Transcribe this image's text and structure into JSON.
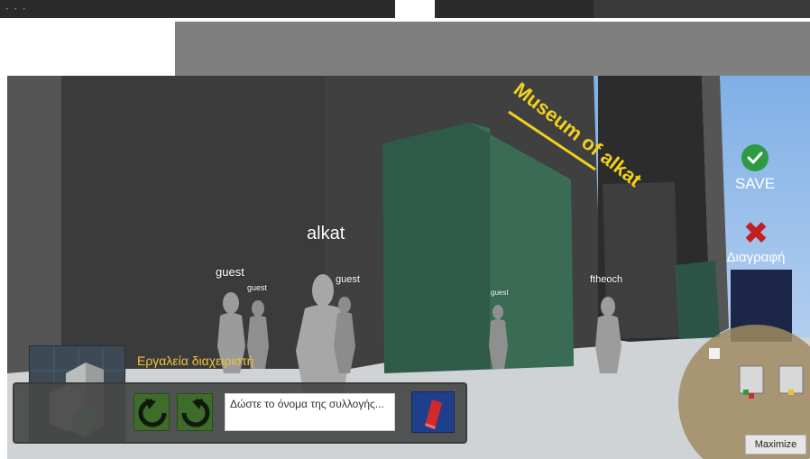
{
  "window": {
    "traffic_dots": "• • •"
  },
  "scene": {
    "building_sign": "Museum of alkat",
    "colors": {
      "sky": "#8db8e8",
      "building": "#3c3c3c",
      "panel": "#2f5a47",
      "sign": "#f2d21d"
    }
  },
  "players": [
    {
      "name": "alkat"
    },
    {
      "name": "guest"
    },
    {
      "name": "guest"
    },
    {
      "name": "guest"
    },
    {
      "name": "guest"
    },
    {
      "name": "ftheoch"
    }
  ],
  "actions": {
    "save": {
      "label": "SAVE",
      "icon": "check-circle-icon",
      "color": "#2e9b44"
    },
    "delete": {
      "label": "Διαγραφή",
      "icon": "x-icon",
      "color": "#c21f1f"
    }
  },
  "admin_tools": {
    "label": "Εργαλεία διαχειριστή",
    "thumbnail_icon": "cube-stack-icon",
    "rotate_left_icon": "rotate-ccw-icon",
    "rotate_right_icon": "rotate-cw-icon",
    "collection_name": {
      "value": "",
      "placeholder": "Δώστε το όνομα της συλλογής..."
    },
    "eraser_icon": "eraser-icon"
  },
  "minimap": {
    "maximize_label": "Maximize"
  }
}
